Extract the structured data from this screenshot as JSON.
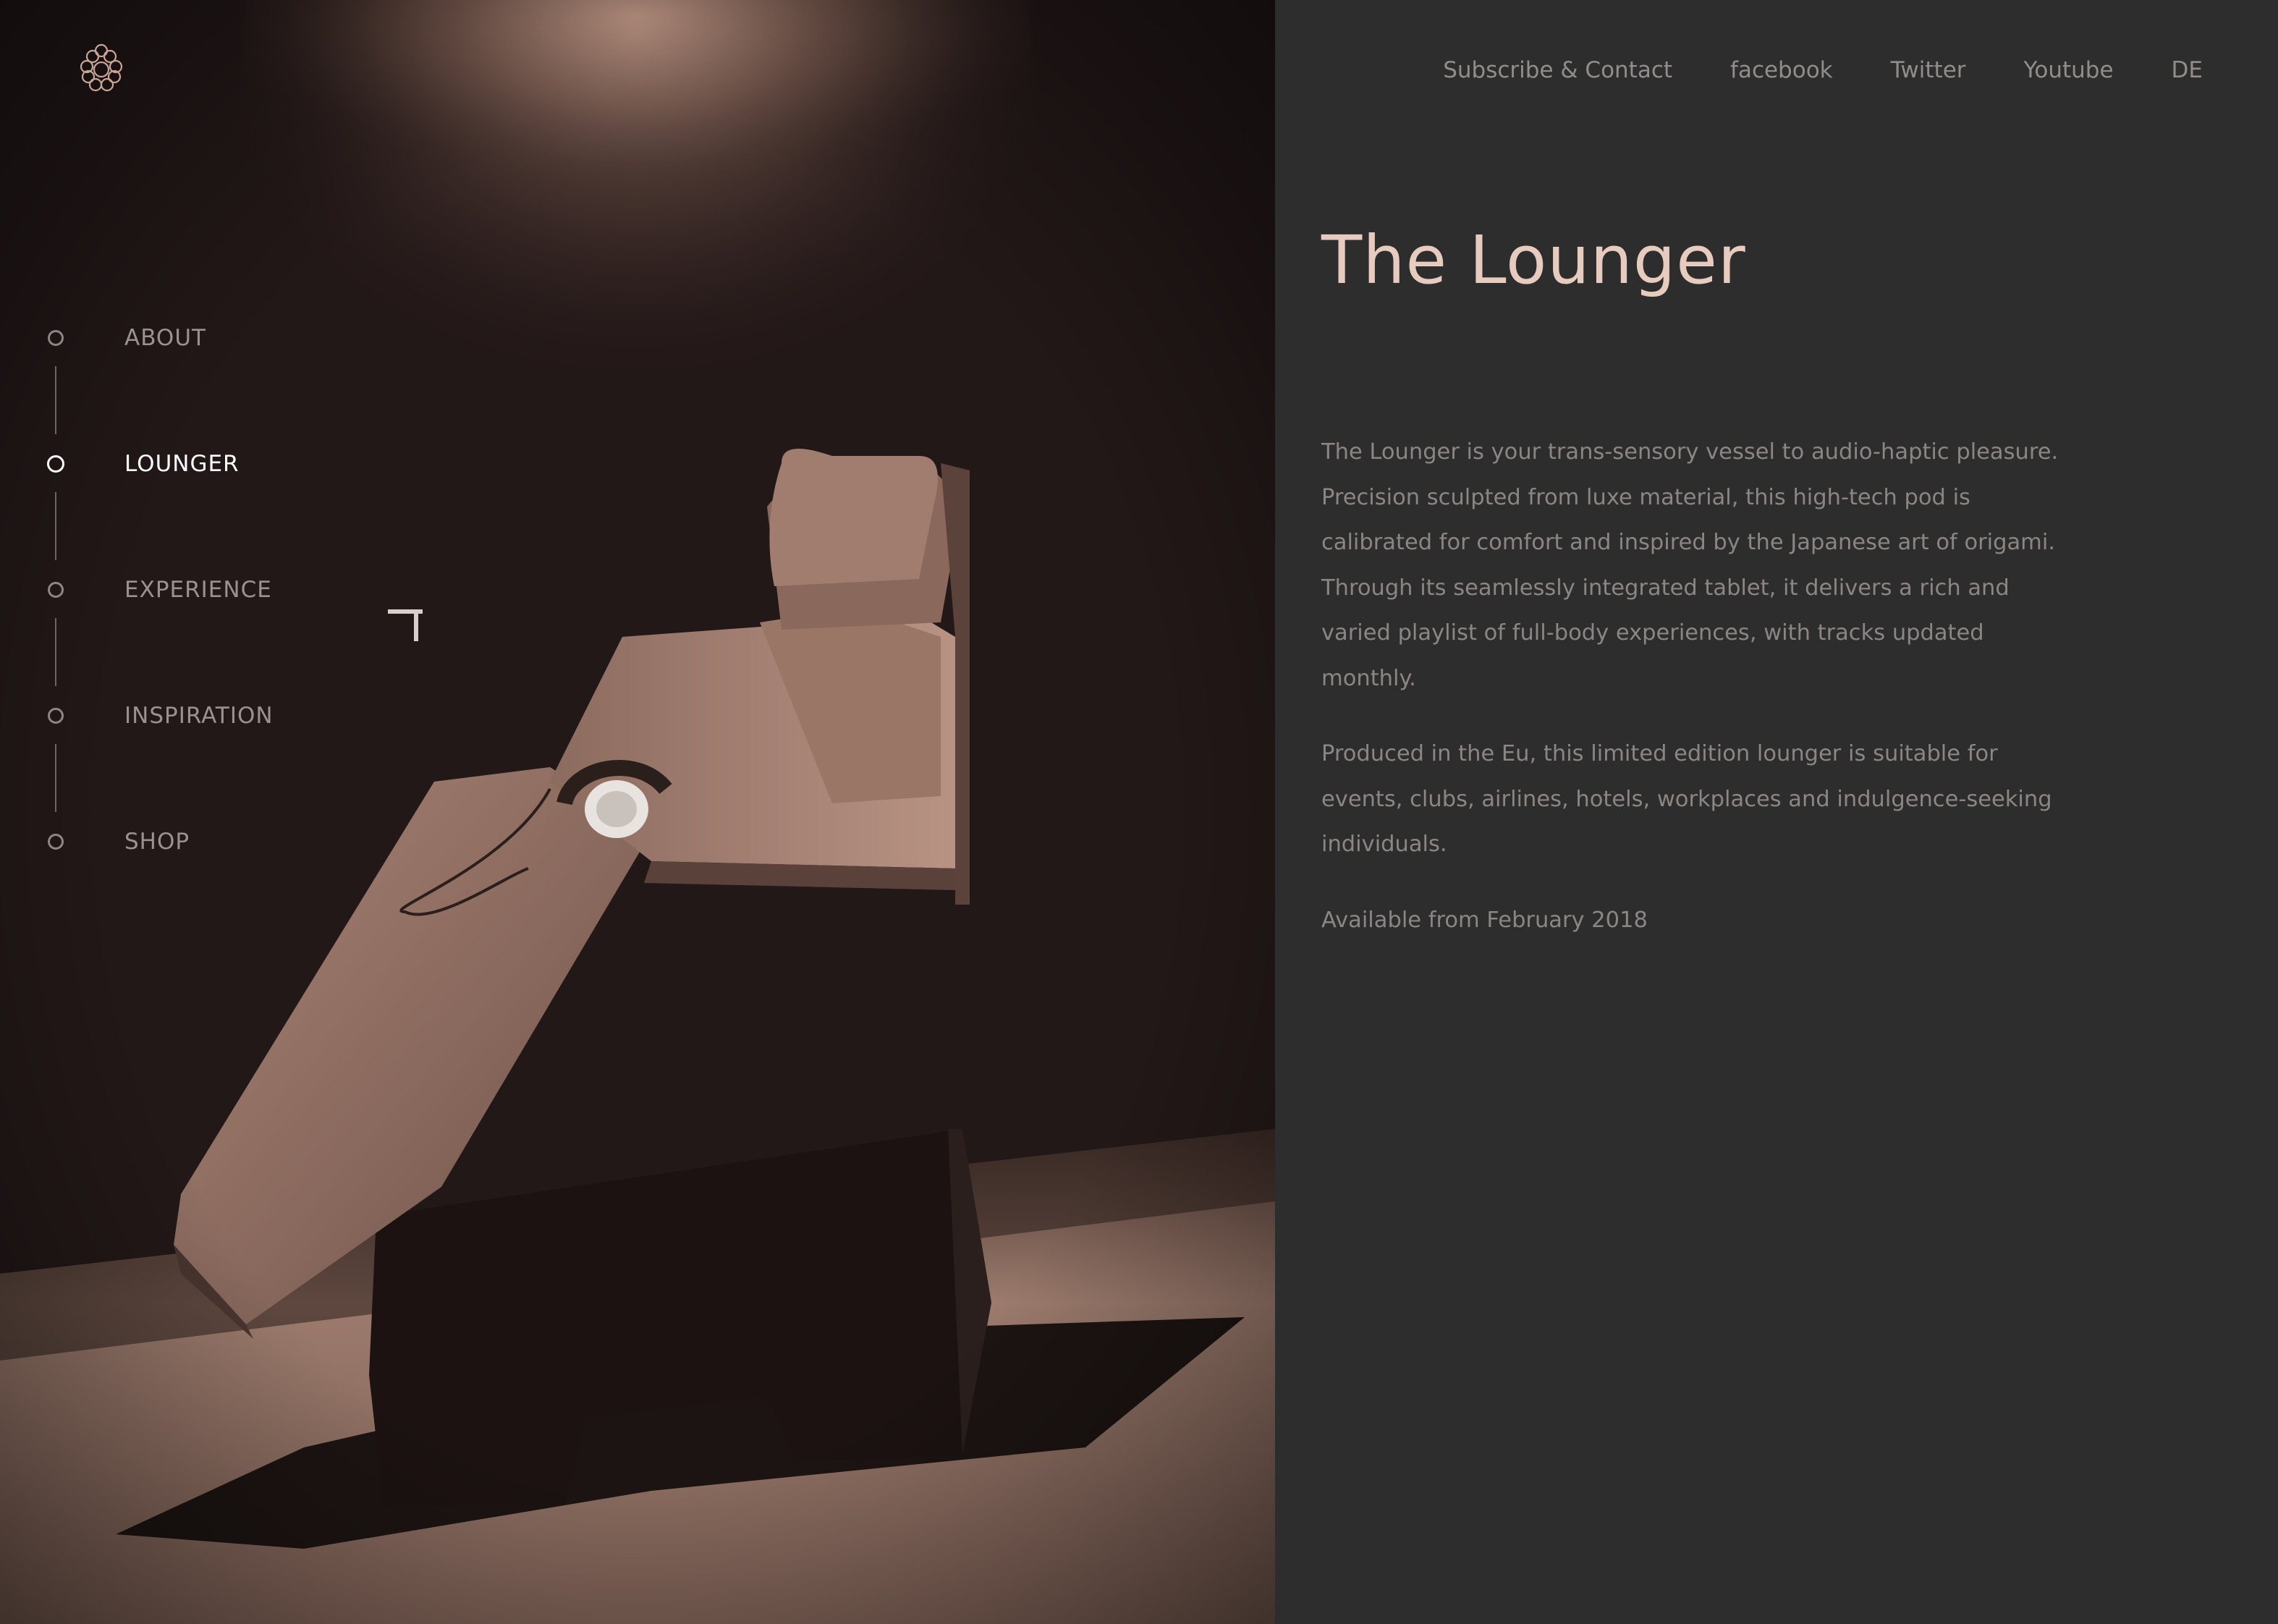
{
  "brand": {
    "logo_icon": "geometric-hexagon-logo",
    "accent_color": "#e8cbbf"
  },
  "top_nav": {
    "items": [
      {
        "label": "Subscribe & Contact"
      },
      {
        "label": "facebook"
      },
      {
        "label": "Twitter"
      },
      {
        "label": "Youtube"
      },
      {
        "label": "DE"
      }
    ]
  },
  "section_nav": {
    "items": [
      {
        "label": "ABOUT",
        "active": false
      },
      {
        "label": "LOUNGER",
        "active": true
      },
      {
        "label": "EXPERIENCE",
        "active": false
      },
      {
        "label": "INSPIRATION",
        "active": false
      },
      {
        "label": "SHOP",
        "active": false
      }
    ]
  },
  "main": {
    "title": "The Lounger",
    "paragraphs": [
      "The Lounger is your trans-sensory vessel to audio-haptic pleasure. Precision sculpted from luxe material, this high-tech pod is calibrated for comfort and inspired by the Japanese art of origami. Through its seamlessly integrated tablet, it delivers a rich and varied playlist of full-body experiences, with tracks updated monthly.",
      "Produced in the Eu, this limited edition lounger is suitable for events, clubs, airlines, hotels, workplaces and indulgence-seeking individuals.",
      "Available from February 2018"
    ]
  },
  "hero_image": {
    "subject": "lounger-chair-photo"
  }
}
